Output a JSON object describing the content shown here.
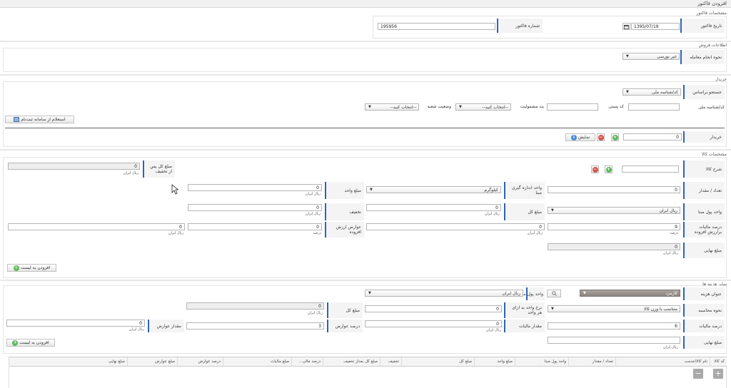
{
  "title": "افزودن فاکتور",
  "invoice": {
    "section_title": "مشخصات فاکتور",
    "date_label": "تاریخ فاکتور",
    "date_value": "1395/07/19",
    "number_label": "شماره فاکتور",
    "number_value": "195956"
  },
  "sales": {
    "section_title": "اطلاعات فروش",
    "method_label": "نحوه انجام معامله",
    "method_value": "غیر بورسی"
  },
  "buyer": {
    "section_title": "خریدار",
    "search_label": "جستجو براساس",
    "search_value": "کد/شناسه ملی",
    "national_id_label": "کد/شناسه ملی",
    "postal_code_label": "کد پستی",
    "taxable_label": "بند مشمولیت",
    "taxable_value": "--انتخاب کنید--",
    "branch_status_label": "وضعیت شعبه",
    "branch_status_value": "--انتخاب کنید--",
    "inquiry_button": "استعلام از سامانه ثبت‌نام",
    "buyer_label": "خریدار",
    "buyer_value": "0",
    "show_button": "نمایش"
  },
  "goods": {
    "section_title": "مشخصات کالا",
    "desc_label": "شرح کالا",
    "qty_label": "تعداد / مقدار",
    "qty_value": "0",
    "unit_label": "واحد اندازه گیری مبنا",
    "unit_value": "کیلوگرم",
    "unit_amount_label": "مبلغ واحد",
    "unit_amount_value": "0",
    "currency_label": "واحد پول مبنا",
    "currency_value": "ریال ایران",
    "total_label": "مبلغ کل",
    "total_value": "0",
    "discount_label": "تخفیف",
    "discount_value": "0",
    "vat_label": "درصد مالیات برارزش افزوده",
    "vat_value": "9",
    "vat_duty_label": "عوارض ارزش افزوده",
    "vat_duty_value": "0",
    "vat_duty_value2": "0",
    "final_label": "مبلغ نهایی",
    "final_value": "0",
    "after_discount_label": "مبلغ کل پس از تخفیف",
    "after_discount_value": "0",
    "rial": "ریال ایران",
    "percent": "درصد",
    "add_button": "افزودن به لیست"
  },
  "other": {
    "section_title": "سایر هزینه ها",
    "cost_title_label": "عنوان هزینه",
    "cost_title_value": "کارمزد",
    "currency_label": "واحد پول مبنا",
    "currency_value": "ریال ایران",
    "calc_label": "نحوه محاسبه",
    "calc_value": "متناسب با وزن کالا",
    "rate_label": "نرخ واحد به ازای هر واحد",
    "rate_value": "0",
    "total_label": "مبلغ کل",
    "total_value": "0",
    "tax_percent_label": "درصد مالیات",
    "tax_percent_value": "6",
    "tax_amount_label": "مقدار مالیات",
    "tax_amount_value": "0",
    "duty_percent_label": "درصد عوارض",
    "duty_percent_value": "3",
    "duty_amount_label": "مقدار عوارض",
    "duty_amount_value": "0",
    "final_label": "مبلغ نهایی",
    "rial": "ریال ایران",
    "add_button": "افزودن به لیست"
  },
  "table": {
    "columns": [
      "کد کالا",
      "نام کالا/خدمت",
      "تعداد / مقدار",
      "واحد پول مبنا",
      "مبلغ واحد",
      "مبلغ کل",
      "تخفیف",
      "مبلغ کل بعداز تخفیف",
      "درصد مالی...",
      "مبلغ مالیات",
      "درصد عوارض",
      "مبلغ عوارض",
      "مبلغ نهایی"
    ],
    "plus": "+",
    "minus": "−"
  },
  "colors": {
    "accent": "#2d63b9",
    "green": "#5cb85c",
    "red": "#d9534f"
  }
}
